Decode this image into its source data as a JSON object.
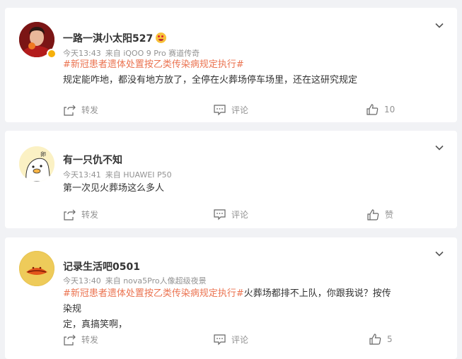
{
  "comments": [
    {
      "username": "一路一淇小太阳527",
      "time": "今天13:43",
      "source": "来自 iQOO 9 Pro 赛道传奇",
      "topic": "#新冠患者遗体处置按乙类传染病规定执行#",
      "line1": "规定能咋地，都没有地方放了，全停在火葬场停车场里，还在这研究规定",
      "forward_label": "转发",
      "comment_label": "评论",
      "like_count": "10"
    },
    {
      "username": "有一只仇不知",
      "time": "今天13:41",
      "source": "来自 HUAWEI P50",
      "line1": "第一次见火葬场这么多人",
      "forward_label": "转发",
      "comment_label": "评论",
      "like_count": "赞"
    },
    {
      "username": "记录生活吧0501",
      "time": "今天13:40",
      "source": "来自 nova5Pro人像超级夜景",
      "topic": "#新冠患者遗体处置按乙类传染病规定执行#",
      "line1_rest": "火葬场都排不上队，你跟我说？按传染规",
      "line2": "定，真搞笑啊，",
      "forward_label": "转发",
      "comment_label": "评论",
      "like_count": "5"
    }
  ],
  "icons": {
    "more": "chevron-down-icon",
    "forward": "forward-icon",
    "comment": "comment-icon",
    "like": "thumbs-up-icon"
  },
  "colors": {
    "topic": "#eb7350",
    "background": "#f1f2f5",
    "meta": "#939393",
    "verified_badge": "#f6b00a"
  }
}
